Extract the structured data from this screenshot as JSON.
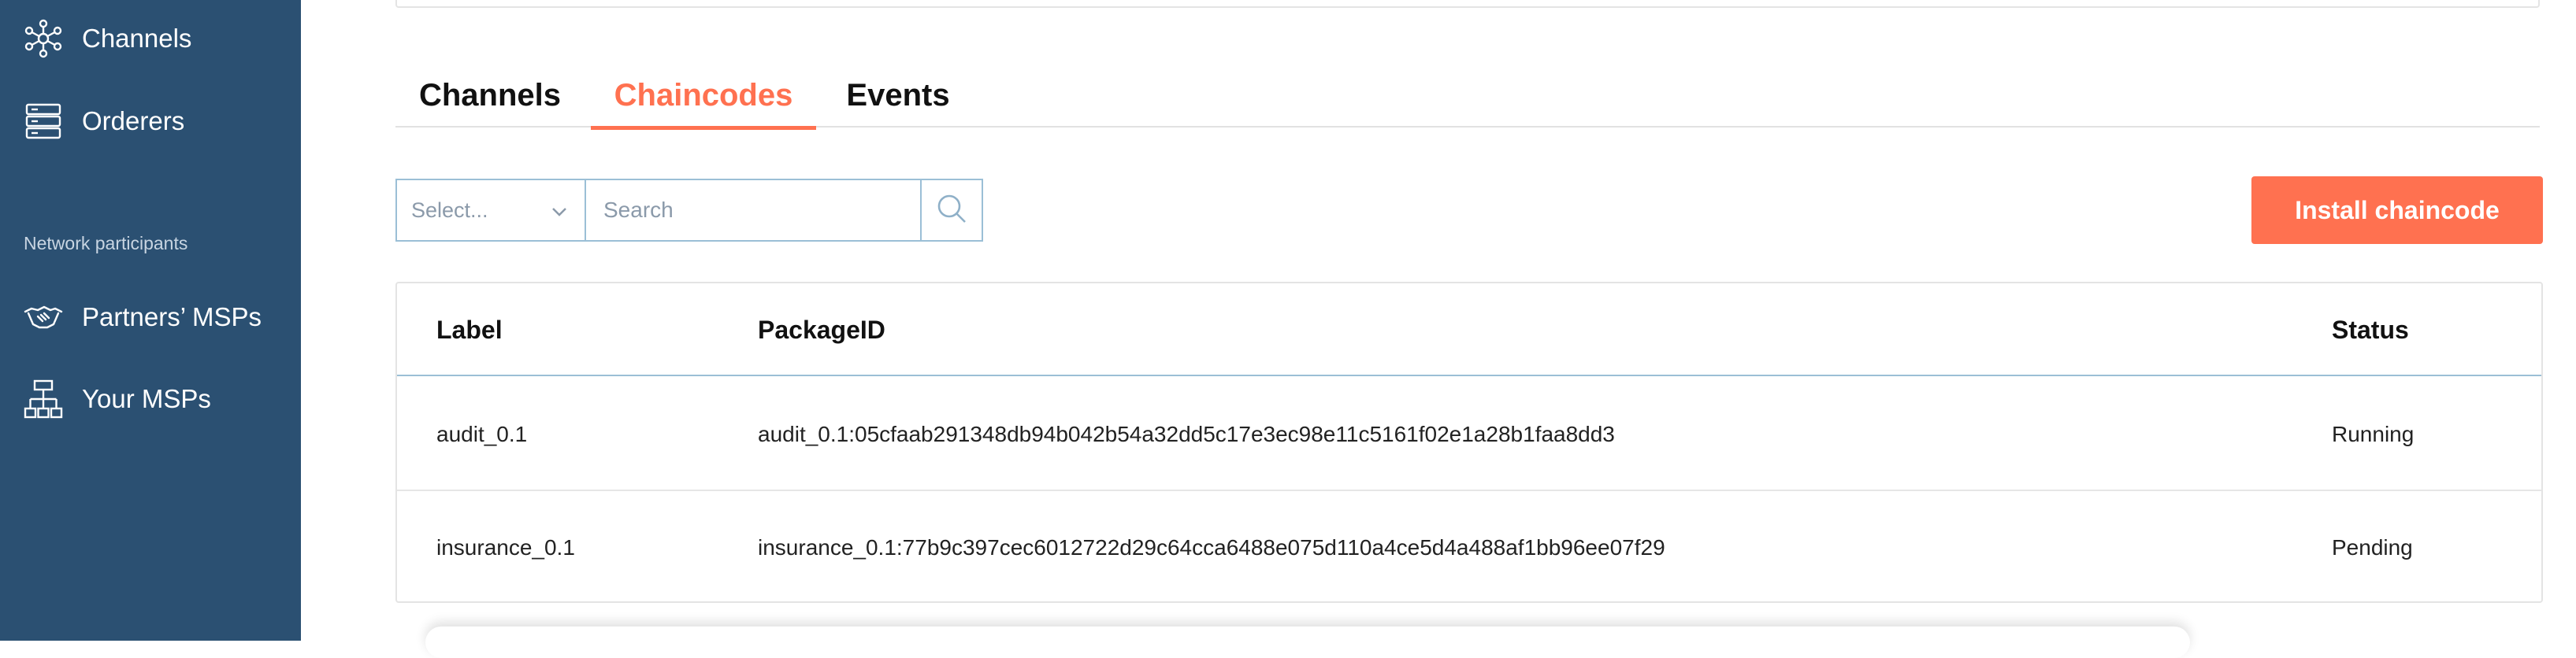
{
  "sidebar": {
    "items_top": [
      {
        "label": "Channels",
        "icon": "network-nodes-icon"
      },
      {
        "label": "Orderers",
        "icon": "server-stack-icon"
      }
    ],
    "section_title": "Network participants",
    "items_bottom": [
      {
        "label": "Partners’ MSPs",
        "icon": "handshake-icon"
      },
      {
        "label": "Your MSPs",
        "icon": "org-chart-icon"
      }
    ],
    "background_color": "#2b5072"
  },
  "tabs": [
    {
      "label": "Channels",
      "active": false
    },
    {
      "label": "Chaincodes",
      "active": true
    },
    {
      "label": "Events",
      "active": false
    }
  ],
  "filters": {
    "select_placeholder": "Select...",
    "search_placeholder": "Search"
  },
  "actions": {
    "install_label": "Install chaincode",
    "accent_color": "#ff7150"
  },
  "table": {
    "headers": {
      "label": "Label",
      "package_id": "PackageID",
      "status": "Status"
    },
    "rows": [
      {
        "label": "audit_0.1",
        "package_id": "audit_0.1:05cfaab291348db94b042b54a32dd5c17e3ec98e11c5161f02e1a28b1faa8dd3",
        "status": "Running"
      },
      {
        "label": "insurance_0.1",
        "package_id": "insurance_0.1:77b9c397cec6012722d29c64cca6488e075d110a4ce5d4a488af1bb96ee07f29",
        "status": "Pending"
      }
    ]
  }
}
